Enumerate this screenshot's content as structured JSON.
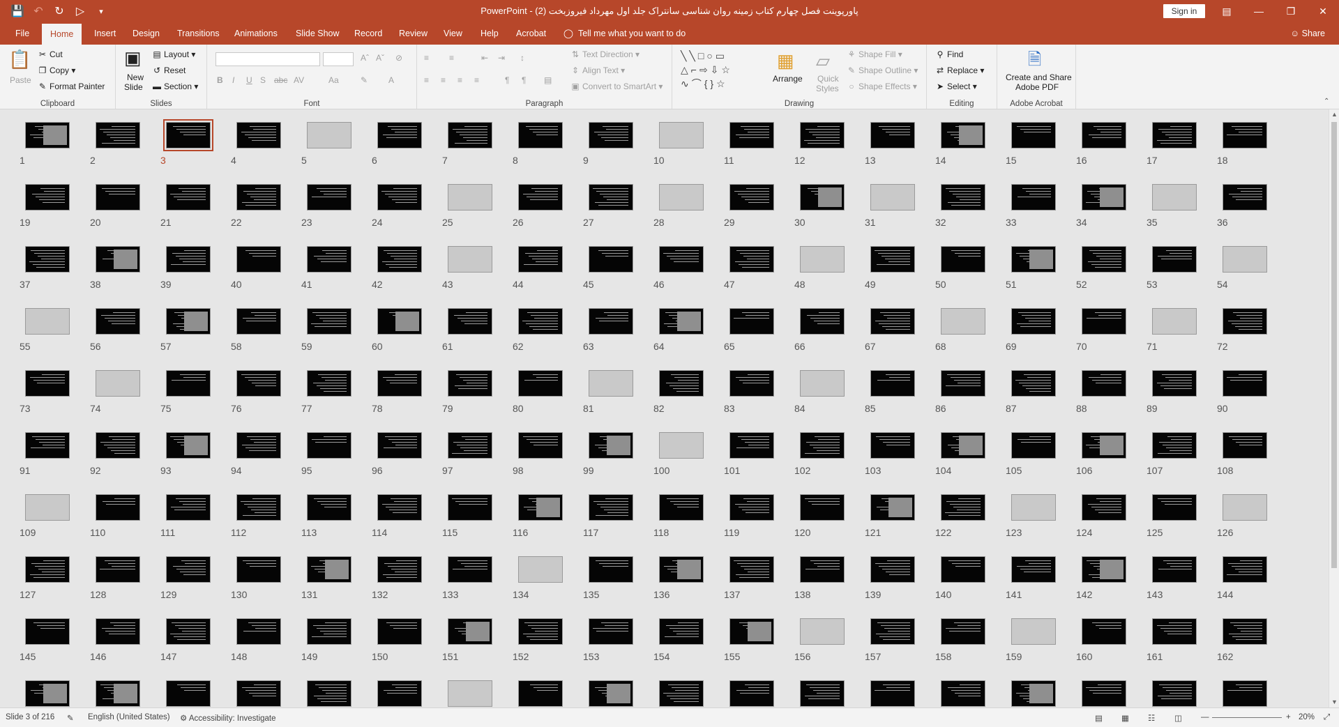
{
  "window": {
    "title": "پاورپوینت فصل چهارم کتاب زمینه روان شناسی سانتراک جلد اول مهرداد فیروزبخت (2)  -  PowerPoint",
    "sign_in": "Sign in"
  },
  "tabs": [
    {
      "label": "File"
    },
    {
      "label": "Home"
    },
    {
      "label": "Insert"
    },
    {
      "label": "Design"
    },
    {
      "label": "Transitions"
    },
    {
      "label": "Animations"
    },
    {
      "label": "Slide Show"
    },
    {
      "label": "Record"
    },
    {
      "label": "Review"
    },
    {
      "label": "View"
    },
    {
      "label": "Help"
    },
    {
      "label": "Acrobat"
    }
  ],
  "tell_me": "Tell me what you want to do",
  "share": "Share",
  "ribbon": {
    "clipboard": {
      "label": "Clipboard",
      "paste": "Paste",
      "cut": "Cut",
      "copy": "Copy",
      "format_painter": "Format Painter"
    },
    "slides": {
      "label": "Slides",
      "new_slide_1": "New",
      "new_slide_2": "Slide",
      "layout": "Layout",
      "reset": "Reset",
      "section": "Section"
    },
    "font": {
      "label": "Font"
    },
    "paragraph": {
      "label": "Paragraph",
      "text_direction": "Text Direction",
      "align_text": "Align Text",
      "convert_smartart": "Convert to SmartArt"
    },
    "drawing": {
      "label": "Drawing",
      "arrange": "Arrange",
      "quick_styles_1": "Quick",
      "quick_styles_2": "Styles",
      "shape_fill": "Shape Fill",
      "shape_outline": "Shape Outline",
      "shape_effects": "Shape Effects"
    },
    "editing": {
      "label": "Editing",
      "find": "Find",
      "replace": "Replace",
      "select": "Select"
    },
    "acrobat": {
      "label": "Adobe Acrobat",
      "create_1": "Create and Share",
      "create_2": "Adobe PDF"
    }
  },
  "slides": {
    "total_visible": 180,
    "selected": 3
  },
  "status": {
    "slide_info": "Slide 3 of 216",
    "language": "English (United States)",
    "accessibility": "Accessibility: Investigate",
    "zoom": "20%"
  }
}
